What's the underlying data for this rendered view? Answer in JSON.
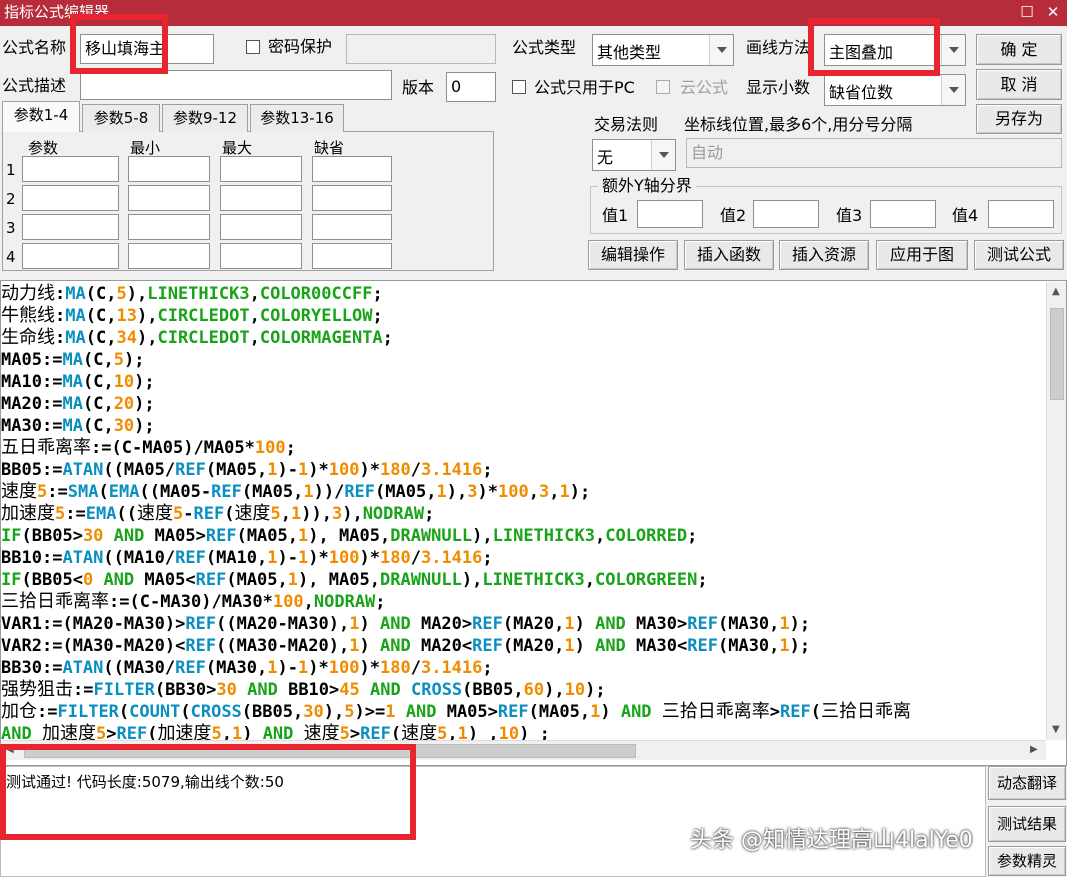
{
  "window": {
    "title": "指标公式编辑器",
    "min_glyph": "☐",
    "close_glyph": "✕"
  },
  "form": {
    "name_label": "公式名称",
    "name_value": "移山填海主",
    "password_label": "密码保护",
    "type_label": "公式类型",
    "type_value": "其他类型",
    "draw_label": "画线方法",
    "draw_value": "主图叠加",
    "desc_label": "公式描述",
    "version_label": "版本",
    "version_value": "0",
    "pc_only_label": "公式只用于PC",
    "cloud_label": "云公式",
    "decimals_label": "显示小数",
    "decimals_value": "缺省位数"
  },
  "buttons": {
    "ok": "确 定",
    "cancel": "取 消",
    "save_as": "另存为",
    "edit_ops": "编辑操作",
    "insert_func": "插入函数",
    "insert_res": "插入资源",
    "apply": "应用于图",
    "test": "测试公式",
    "dyn_translate": "动态翻译",
    "test_result": "测试结果",
    "param_wizard": "参数精灵"
  },
  "tabs": [
    "参数1-4",
    "参数5-8",
    "参数9-12",
    "参数13-16"
  ],
  "params": {
    "headers": [
      "参数",
      "最小",
      "最大",
      "缺省"
    ],
    "rows": [
      "1",
      "2",
      "3",
      "4"
    ]
  },
  "trade": {
    "rule_label": "交易法则",
    "rule_value": "无",
    "axis_label": "坐标线位置,最多6个,用分号分隔",
    "axis_value": "自动",
    "extra_y_label": "额外Y轴分界",
    "val_labels": [
      "值1",
      "值2",
      "值3",
      "值4"
    ]
  },
  "code": [
    "动力线:MA(C,5),LINETHICK3,COLOR00CCFF;",
    "牛熊线:MA(C,13),CIRCLEDOT,COLORYELLOW;",
    "生命线:MA(C,34),CIRCLEDOT,COLORMAGENTA;",
    "MA05:=MA(C,5);",
    "MA10:=MA(C,10);",
    "MA20:=MA(C,20);",
    "MA30:=MA(C,30);",
    "五日乖离率:=(C-MA05)/MA05*100;",
    "BB05:=ATAN((MA05/REF(MA05,1)-1)*100)*180/3.1416;",
    "速度5:=SMA(EMA((MA05-REF(MA05,1))/REF(MA05,1),3)*100,3,1);",
    "加速度5:=EMA((速度5-REF(速度5,1)),3),NODRAW;",
    "IF(BB05>30 AND MA05>REF(MA05,1), MA05,DRAWNULL),LINETHICK3,COLORRED;",
    "BB10:=ATAN((MA10/REF(MA10,1)-1)*100)*180/3.1416;",
    "IF(BB05<0 AND MA05<REF(MA05,1), MA05,DRAWNULL),LINETHICK3,COLORGREEN;",
    "三拾日乖离率:=(C-MA30)/MA30*100,NODRAW;",
    "VAR1:=(MA20-MA30)>REF((MA20-MA30),1) AND MA20>REF(MA20,1) AND MA30>REF(MA30,1);",
    "VAR2:=(MA30-MA20)<REF((MA30-MA20),1) AND MA20<REF(MA20,1) AND MA30<REF(MA30,1);",
    "BB30:=ATAN((MA30/REF(MA30,1)-1)*100)*180/3.1416;",
    "强势狙击:=FILTER(BB30>30 AND BB10>45 AND CROSS(BB05,60),10);",
    "加仓:=FILTER(COUNT(CROSS(BB05,30),5)>=1 AND MA05>REF(MA05,1) AND 三拾日乖离率>REF(三拾日乖离",
    "AND 加速度5>REF(加速度5,1) AND 速度5>REF(速度5,1) ,10) ;"
  ],
  "status": {
    "message": "测试通过! 代码长度:5079,输出线个数:50"
  },
  "watermark": "头条 @知情达理高山4lalYe0",
  "colors": {
    "titlebar": "#b62c3a",
    "highlight_box": "#e8242f",
    "code_function": "#0a8fc0",
    "code_number": "#f08c00",
    "code_keyword": "#19a319"
  }
}
